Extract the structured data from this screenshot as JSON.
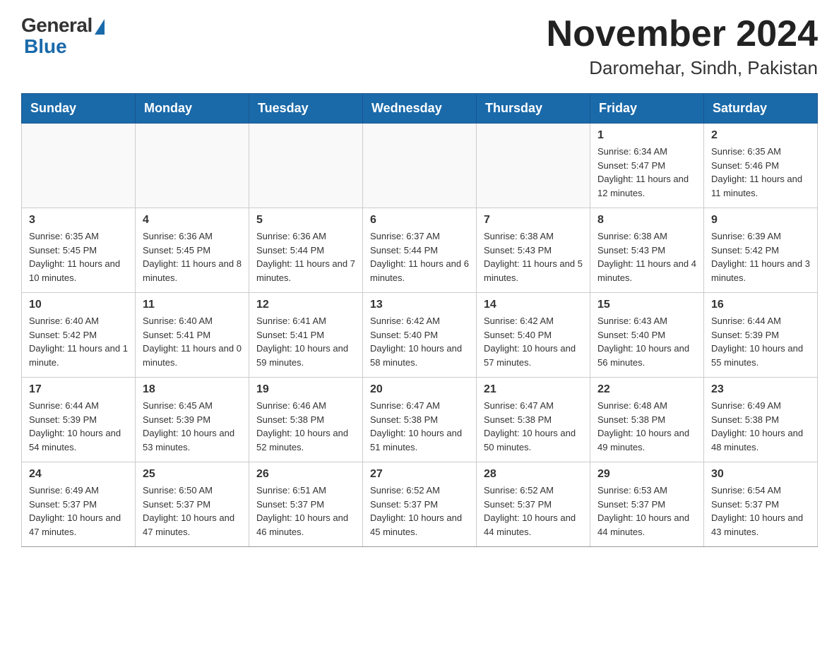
{
  "header": {
    "logo_general": "General",
    "logo_blue": "Blue",
    "month_title": "November 2024",
    "location": "Daromehar, Sindh, Pakistan"
  },
  "days_of_week": [
    "Sunday",
    "Monday",
    "Tuesday",
    "Wednesday",
    "Thursday",
    "Friday",
    "Saturday"
  ],
  "weeks": [
    [
      {
        "day": "",
        "info": ""
      },
      {
        "day": "",
        "info": ""
      },
      {
        "day": "",
        "info": ""
      },
      {
        "day": "",
        "info": ""
      },
      {
        "day": "",
        "info": ""
      },
      {
        "day": "1",
        "info": "Sunrise: 6:34 AM\nSunset: 5:47 PM\nDaylight: 11 hours and 12 minutes."
      },
      {
        "day": "2",
        "info": "Sunrise: 6:35 AM\nSunset: 5:46 PM\nDaylight: 11 hours and 11 minutes."
      }
    ],
    [
      {
        "day": "3",
        "info": "Sunrise: 6:35 AM\nSunset: 5:45 PM\nDaylight: 11 hours and 10 minutes."
      },
      {
        "day": "4",
        "info": "Sunrise: 6:36 AM\nSunset: 5:45 PM\nDaylight: 11 hours and 8 minutes."
      },
      {
        "day": "5",
        "info": "Sunrise: 6:36 AM\nSunset: 5:44 PM\nDaylight: 11 hours and 7 minutes."
      },
      {
        "day": "6",
        "info": "Sunrise: 6:37 AM\nSunset: 5:44 PM\nDaylight: 11 hours and 6 minutes."
      },
      {
        "day": "7",
        "info": "Sunrise: 6:38 AM\nSunset: 5:43 PM\nDaylight: 11 hours and 5 minutes."
      },
      {
        "day": "8",
        "info": "Sunrise: 6:38 AM\nSunset: 5:43 PM\nDaylight: 11 hours and 4 minutes."
      },
      {
        "day": "9",
        "info": "Sunrise: 6:39 AM\nSunset: 5:42 PM\nDaylight: 11 hours and 3 minutes."
      }
    ],
    [
      {
        "day": "10",
        "info": "Sunrise: 6:40 AM\nSunset: 5:42 PM\nDaylight: 11 hours and 1 minute."
      },
      {
        "day": "11",
        "info": "Sunrise: 6:40 AM\nSunset: 5:41 PM\nDaylight: 11 hours and 0 minutes."
      },
      {
        "day": "12",
        "info": "Sunrise: 6:41 AM\nSunset: 5:41 PM\nDaylight: 10 hours and 59 minutes."
      },
      {
        "day": "13",
        "info": "Sunrise: 6:42 AM\nSunset: 5:40 PM\nDaylight: 10 hours and 58 minutes."
      },
      {
        "day": "14",
        "info": "Sunrise: 6:42 AM\nSunset: 5:40 PM\nDaylight: 10 hours and 57 minutes."
      },
      {
        "day": "15",
        "info": "Sunrise: 6:43 AM\nSunset: 5:40 PM\nDaylight: 10 hours and 56 minutes."
      },
      {
        "day": "16",
        "info": "Sunrise: 6:44 AM\nSunset: 5:39 PM\nDaylight: 10 hours and 55 minutes."
      }
    ],
    [
      {
        "day": "17",
        "info": "Sunrise: 6:44 AM\nSunset: 5:39 PM\nDaylight: 10 hours and 54 minutes."
      },
      {
        "day": "18",
        "info": "Sunrise: 6:45 AM\nSunset: 5:39 PM\nDaylight: 10 hours and 53 minutes."
      },
      {
        "day": "19",
        "info": "Sunrise: 6:46 AM\nSunset: 5:38 PM\nDaylight: 10 hours and 52 minutes."
      },
      {
        "day": "20",
        "info": "Sunrise: 6:47 AM\nSunset: 5:38 PM\nDaylight: 10 hours and 51 minutes."
      },
      {
        "day": "21",
        "info": "Sunrise: 6:47 AM\nSunset: 5:38 PM\nDaylight: 10 hours and 50 minutes."
      },
      {
        "day": "22",
        "info": "Sunrise: 6:48 AM\nSunset: 5:38 PM\nDaylight: 10 hours and 49 minutes."
      },
      {
        "day": "23",
        "info": "Sunrise: 6:49 AM\nSunset: 5:38 PM\nDaylight: 10 hours and 48 minutes."
      }
    ],
    [
      {
        "day": "24",
        "info": "Sunrise: 6:49 AM\nSunset: 5:37 PM\nDaylight: 10 hours and 47 minutes."
      },
      {
        "day": "25",
        "info": "Sunrise: 6:50 AM\nSunset: 5:37 PM\nDaylight: 10 hours and 47 minutes."
      },
      {
        "day": "26",
        "info": "Sunrise: 6:51 AM\nSunset: 5:37 PM\nDaylight: 10 hours and 46 minutes."
      },
      {
        "day": "27",
        "info": "Sunrise: 6:52 AM\nSunset: 5:37 PM\nDaylight: 10 hours and 45 minutes."
      },
      {
        "day": "28",
        "info": "Sunrise: 6:52 AM\nSunset: 5:37 PM\nDaylight: 10 hours and 44 minutes."
      },
      {
        "day": "29",
        "info": "Sunrise: 6:53 AM\nSunset: 5:37 PM\nDaylight: 10 hours and 44 minutes."
      },
      {
        "day": "30",
        "info": "Sunrise: 6:54 AM\nSunset: 5:37 PM\nDaylight: 10 hours and 43 minutes."
      }
    ]
  ]
}
